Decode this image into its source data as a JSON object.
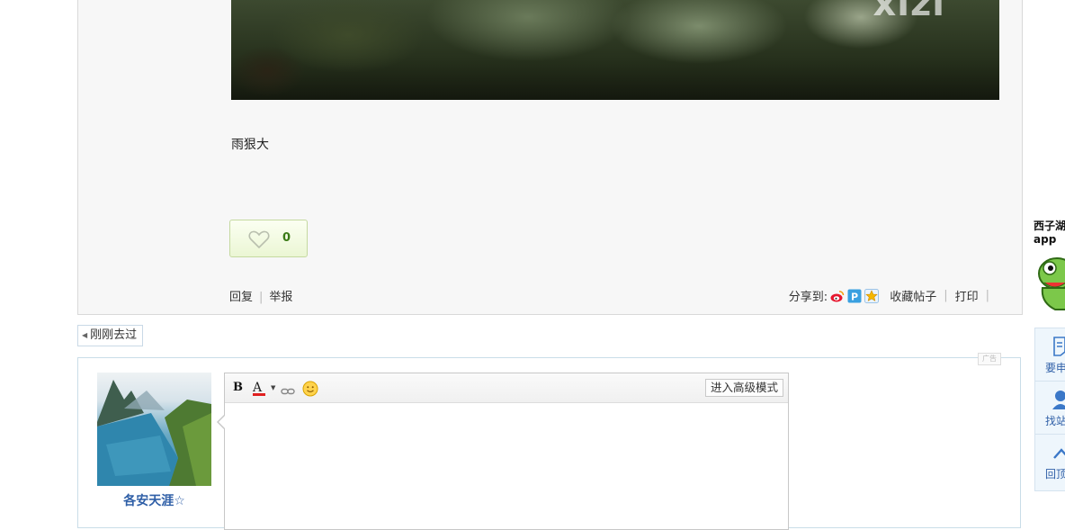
{
  "post": {
    "image_watermark": "xizi",
    "text": "雨狠大",
    "like_count": "0",
    "actions": {
      "reply": "回复",
      "report": "举报"
    },
    "share": {
      "label": "分享到:",
      "targets": [
        "weibo-icon",
        "qzone-icon",
        "favorite-star-icon"
      ],
      "favorite": "收藏帖子",
      "print": "打印"
    }
  },
  "recent": {
    "label": "刚刚去过"
  },
  "ad_tag": "广告",
  "reply_box": {
    "username": "各安天涯☆",
    "toolbar": {
      "bold": "B",
      "font_color": "A",
      "advanced_mode": "进入高级模式"
    }
  },
  "app_promo": {
    "line1": "西子湖",
    "line2": "app"
  },
  "side_tools": [
    {
      "label": "要申",
      "icon": "edit-doc-icon"
    },
    {
      "label": "找站",
      "icon": "user-icon"
    },
    {
      "label": "回顶",
      "icon": "back-to-top-icon"
    }
  ],
  "colors": {
    "link_blue": "#2f5fa7",
    "like_green": "#3a7a16",
    "border_blue": "#c9dde8",
    "panel_grey": "#f7f7f7"
  }
}
